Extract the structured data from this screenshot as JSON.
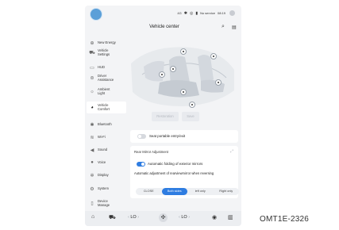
{
  "status_bar": {
    "signal_text": "4G",
    "network_label": "No service",
    "time": "08:19"
  },
  "header": {
    "title": "Vehicle center",
    "search_icon": "search-icon",
    "menu_icon": "list-icon"
  },
  "sidebar": {
    "items": [
      {
        "label": "New Energy",
        "icon": "leaf-icon"
      },
      {
        "label": "Vehicle Settings",
        "icon": "car-icon"
      },
      {
        "label": "HUD",
        "icon": "hud-icon"
      },
      {
        "label": "Driver Assistance",
        "icon": "steering-icon"
      },
      {
        "label": "Ambient Light",
        "icon": "sun-icon"
      },
      {
        "label": "Vehicle Comfort",
        "icon": "seat-icon",
        "active": true
      },
      {
        "label": "Bluetooth",
        "icon": "bluetooth-icon"
      },
      {
        "label": "Wi-Fi",
        "icon": "wifi-icon"
      },
      {
        "label": "Sound",
        "icon": "speaker-icon"
      },
      {
        "label": "Voice",
        "icon": "mic-icon"
      },
      {
        "label": "Display",
        "icon": "brightness-icon"
      },
      {
        "label": "System",
        "icon": "gear-icon"
      },
      {
        "label": "Device Manage",
        "icon": "device-icon"
      }
    ]
  },
  "main": {
    "restoration_label": "Restoration",
    "save_label": "Save",
    "seat_portable": {
      "label": "Seat portable entry/exit",
      "enabled": false
    },
    "mirror_card": {
      "title": "Rear Mirror Adjustment",
      "auto_fold_label": "Automatic folding of exterior mirrors",
      "auto_fold_enabled": true,
      "auto_adjust_label": "Automatic adjustment of rearviewmirror when reversing",
      "options": [
        "CLOSE",
        "Both sides",
        "left only",
        "Right only"
      ],
      "selected": "Both sides"
    }
  },
  "bottom_bar": {
    "left_temp": "LO",
    "right_temp": "LO",
    "icons": [
      "home-icon",
      "car-icon",
      "fan-icon",
      "steering-heat-icon",
      "grid-icon"
    ]
  },
  "figure_code": "OMT1E-2326",
  "colors": {
    "accent": "#2f7de1",
    "background": "#f3f4f6"
  }
}
